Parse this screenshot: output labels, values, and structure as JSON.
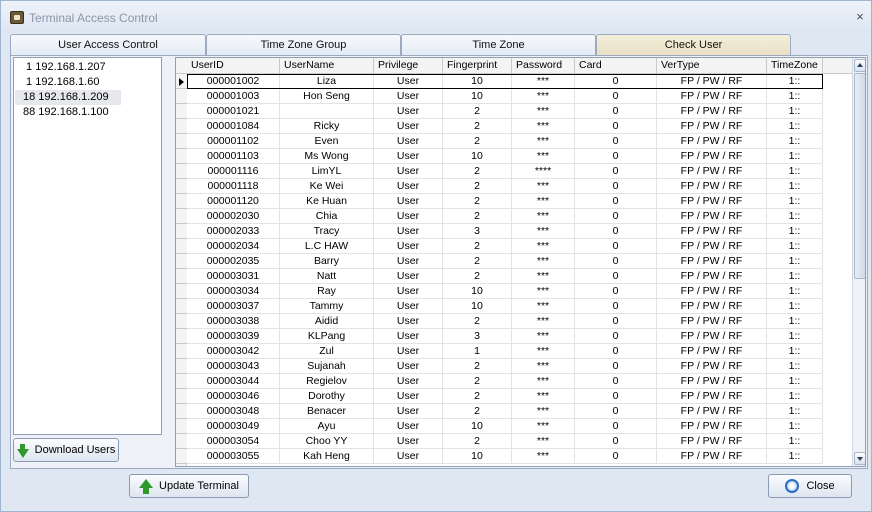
{
  "window": {
    "title": "Terminal Access Control",
    "close_glyph": "×"
  },
  "tabs": [
    {
      "label": "User Access Control"
    },
    {
      "label": "Time Zone Group"
    },
    {
      "label": "Time Zone"
    },
    {
      "label": "Check User",
      "active": true
    }
  ],
  "devices": [
    {
      "label": " 1 192.168.1.207"
    },
    {
      "label": " 1 192.168.1.60"
    },
    {
      "label": "18 192.168.1.209",
      "selected": true
    },
    {
      "label": "88 192.168.1.100"
    }
  ],
  "buttons": {
    "download_users": "Download Users",
    "update_terminal": "Update Terminal",
    "close": "Close"
  },
  "icons": {
    "download": "green-down-arrow-icon",
    "update": "green-up-arrow-icon",
    "close": "refresh-circle-icon"
  },
  "grid": {
    "columns": [
      "UserID",
      "UserName",
      "Privilege",
      "Fingerprint",
      "Password",
      "Card",
      "VerType",
      "TimeZone"
    ],
    "rows": [
      [
        "000001002",
        "Liza",
        "User",
        "10",
        "***",
        "0",
        "FP / PW / RF",
        "1::"
      ],
      [
        "000001003",
        "Hon Seng",
        "User",
        "10",
        "***",
        "0",
        "FP / PW / RF",
        "1::"
      ],
      [
        "000001021",
        "",
        "User",
        "2",
        "***",
        "0",
        "FP / PW / RF",
        "1::"
      ],
      [
        "000001084",
        "Ricky",
        "User",
        "2",
        "***",
        "0",
        "FP / PW / RF",
        "1::"
      ],
      [
        "000001102",
        "Even",
        "User",
        "2",
        "***",
        "0",
        "FP / PW / RF",
        "1::"
      ],
      [
        "000001103",
        "Ms Wong",
        "User",
        "10",
        "***",
        "0",
        "FP / PW / RF",
        "1::"
      ],
      [
        "000001116",
        "LimYL",
        "User",
        "2",
        "****",
        "0",
        "FP / PW / RF",
        "1::"
      ],
      [
        "000001118",
        "Ke Wei",
        "User",
        "2",
        "***",
        "0",
        "FP / PW / RF",
        "1::"
      ],
      [
        "000001120",
        "Ke Huan",
        "User",
        "2",
        "***",
        "0",
        "FP / PW / RF",
        "1::"
      ],
      [
        "000002030",
        "Chia",
        "User",
        "2",
        "***",
        "0",
        "FP / PW / RF",
        "1::"
      ],
      [
        "000002033",
        "Tracy",
        "User",
        "3",
        "***",
        "0",
        "FP / PW / RF",
        "1::"
      ],
      [
        "000002034",
        "L.C HAW",
        "User",
        "2",
        "***",
        "0",
        "FP / PW / RF",
        "1::"
      ],
      [
        "000002035",
        "Barry",
        "User",
        "2",
        "***",
        "0",
        "FP / PW / RF",
        "1::"
      ],
      [
        "000003031",
        "Natt",
        "User",
        "2",
        "***",
        "0",
        "FP / PW / RF",
        "1::"
      ],
      [
        "000003034",
        "Ray",
        "User",
        "10",
        "***",
        "0",
        "FP / PW / RF",
        "1::"
      ],
      [
        "000003037",
        "Tammy",
        "User",
        "10",
        "***",
        "0",
        "FP / PW / RF",
        "1::"
      ],
      [
        "000003038",
        "Aidid",
        "User",
        "2",
        "***",
        "0",
        "FP / PW / RF",
        "1::"
      ],
      [
        "000003039",
        "KLPang",
        "User",
        "3",
        "***",
        "0",
        "FP / PW / RF",
        "1::"
      ],
      [
        "000003042",
        "Zul",
        "User",
        "1",
        "***",
        "0",
        "FP / PW / RF",
        "1::"
      ],
      [
        "000003043",
        "Sujanah",
        "User",
        "2",
        "***",
        "0",
        "FP / PW / RF",
        "1::"
      ],
      [
        "000003044",
        "Regielov",
        "User",
        "2",
        "***",
        "0",
        "FP / PW / RF",
        "1::"
      ],
      [
        "000003046",
        "Dorothy",
        "User",
        "2",
        "***",
        "0",
        "FP / PW / RF",
        "1::"
      ],
      [
        "000003048",
        "Benacer",
        "User",
        "2",
        "***",
        "0",
        "FP / PW / RF",
        "1::"
      ],
      [
        "000003049",
        "Ayu",
        "User",
        "10",
        "***",
        "0",
        "FP / PW / RF",
        "1::"
      ],
      [
        "000003054",
        "Choo YY",
        "User",
        "2",
        "***",
        "0",
        "FP / PW / RF",
        "1::"
      ],
      [
        "000003055",
        "Kah Heng",
        "User",
        "10",
        "***",
        "0",
        "FP / PW / RF",
        "1::"
      ]
    ]
  }
}
